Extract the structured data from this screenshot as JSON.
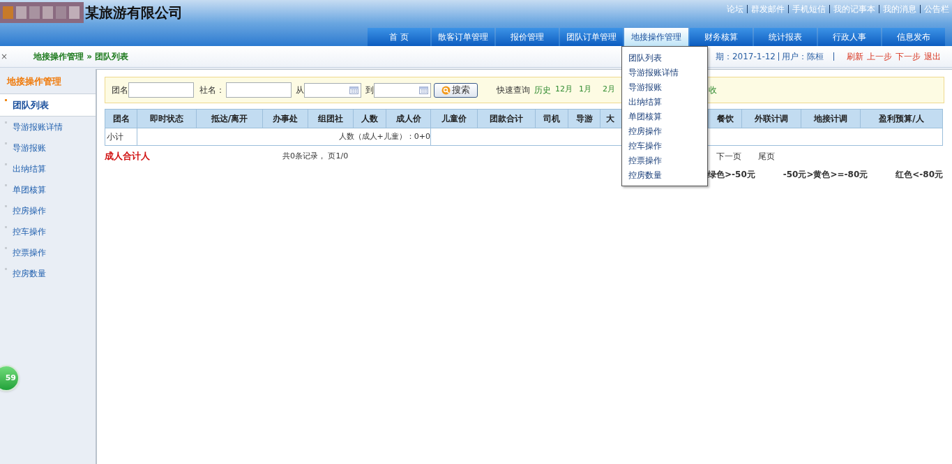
{
  "header": {
    "company": "某旅游有限公司",
    "links": [
      "论坛",
      "群发邮件",
      "手机短信",
      "我的记事本",
      "我的消息",
      "公告栏"
    ]
  },
  "nav": [
    {
      "label": "首 页",
      "selected": false
    },
    {
      "label": "散客订单管理",
      "selected": false
    },
    {
      "label": "报价管理",
      "selected": false
    },
    {
      "label": "团队订单管理",
      "selected": false
    },
    {
      "label": "地接操作管理",
      "selected": true
    },
    {
      "label": "财务核算",
      "selected": false
    },
    {
      "label": "统计报表",
      "selected": false
    },
    {
      "label": "行政人事",
      "selected": false
    },
    {
      "label": "信息发布",
      "selected": false
    }
  ],
  "dropdown": [
    "团队列表",
    "导游报账详情",
    "导游报账",
    "出纳结算",
    "单团核算",
    "控房操作",
    "控车操作",
    "控票操作",
    "控房数量"
  ],
  "breadcrumb": {
    "close": "×",
    "path": "地接操作管理 » 团队列表",
    "date": "期：2017-1-12",
    "user": "用户：陈桓",
    "actions": [
      "刷新",
      "上一步",
      "下一步",
      "退出"
    ]
  },
  "sidebar": {
    "title": "地接操作管理",
    "items": [
      {
        "label": "团队列表",
        "selected": true
      },
      {
        "label": "导游报账详情",
        "selected": false
      },
      {
        "label": "导游报账",
        "selected": false
      },
      {
        "label": "出纳结算",
        "selected": false
      },
      {
        "label": "单团核算",
        "selected": false
      },
      {
        "label": "控房操作",
        "selected": false
      },
      {
        "label": "控车操作",
        "selected": false
      },
      {
        "label": "控票操作",
        "selected": false
      },
      {
        "label": "控房数量",
        "selected": false
      }
    ]
  },
  "search": {
    "fields": [
      {
        "label": "团名",
        "kind": "text"
      },
      {
        "label": "社名：",
        "kind": "text"
      },
      {
        "label": "从",
        "kind": "date"
      },
      {
        "label": "到",
        "kind": "date"
      }
    ],
    "button": "搜索",
    "quick_label": "快速查询",
    "quick_links": [
      "历史",
      "12月",
      "1月",
      "2月"
    ],
    "quick_tail": "收"
  },
  "table": {
    "columns": [
      "团名",
      "即时状态",
      "抵达/离开",
      "办事处",
      "组团社",
      "人数",
      "成人价",
      "儿童价",
      "团款合计",
      "司机",
      "导游",
      "大",
      "餐饮",
      "外联计调",
      "地接计调",
      "盈利预算/人"
    ],
    "subtotal": {
      "label": "小计",
      "text": "人数（成人+儿童）：0+0"
    }
  },
  "footer": {
    "total_label": "成人合计人",
    "records": "共0条记录， 页1/0",
    "pager": [
      "下一页",
      "尾页"
    ],
    "legend": [
      "绿色>-50元",
      "-50元>黄色>=-80元",
      "红色<-80元"
    ]
  },
  "badge": "59"
}
